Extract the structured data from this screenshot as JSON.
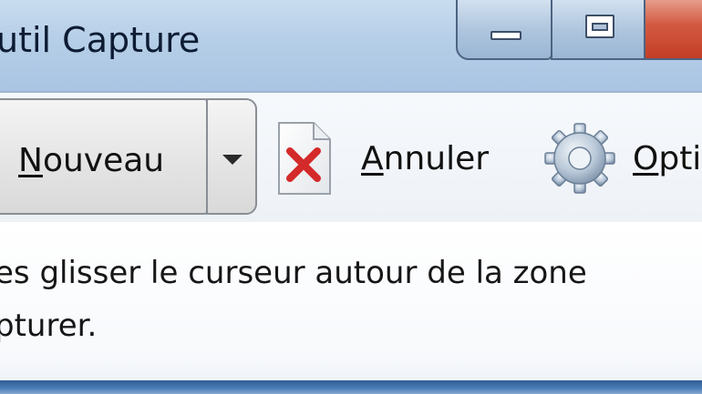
{
  "window": {
    "title": "util Capture"
  },
  "caption_buttons": {
    "minimize_icon": "minimize-icon",
    "maximize_icon": "maximize-icon",
    "close_color": "#c43d25"
  },
  "toolbar": {
    "new": {
      "accel": "N",
      "rest": "ouveau"
    },
    "new_dropdown_icon": "chevron-down-icon",
    "cancel": {
      "accel": "A",
      "rest": "nnuler",
      "icon": "cancel-document-icon"
    },
    "options": {
      "accel": "O",
      "rest": "pti",
      "icon": "gear-icon"
    }
  },
  "message": {
    "line1": "es glisser le curseur autour de la zone",
    "line2": "pturer."
  },
  "colors": {
    "titlebar": "#b7cfe8",
    "toolbar": "#eef2f7",
    "frame": "#3f6fa6"
  }
}
